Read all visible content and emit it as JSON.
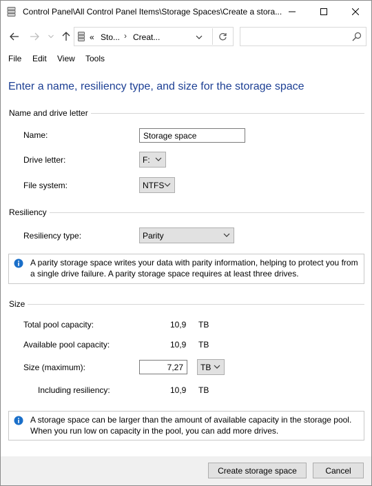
{
  "window": {
    "title": "Control Panel\\All Control Panel Items\\Storage Spaces\\Create a stora...",
    "minimize_glyph": "—",
    "maximize_glyph": "☐",
    "close_glyph": "✕"
  },
  "address": {
    "chevron": "«",
    "crumbs": [
      "Sto...",
      "Creat..."
    ],
    "separator": "›",
    "search_placeholder": ""
  },
  "menu": {
    "items": [
      "File",
      "Edit",
      "View",
      "Tools"
    ]
  },
  "heading": "Enter a name, resiliency type, and size for the storage space",
  "name_section": {
    "title": "Name and drive letter",
    "name_label": "Name:",
    "name_value": "Storage space",
    "drive_label": "Drive letter:",
    "drive_value": "F:",
    "fs_label": "File system:",
    "fs_value": "NTFS"
  },
  "resiliency_section": {
    "title": "Resiliency",
    "type_label": "Resiliency type:",
    "type_value": "Parity",
    "info": "A parity storage space writes your data with parity information, helping to protect you from a single drive failure. A parity storage space requires at least three drives."
  },
  "size_section": {
    "title": "Size",
    "total_label": "Total pool capacity:",
    "total_value": "10,9",
    "total_unit": "TB",
    "available_label": "Available pool capacity:",
    "available_value": "10,9",
    "available_unit": "TB",
    "size_label": "Size (maximum):",
    "size_value": "7,27",
    "size_unit": "TB",
    "including_label": "Including resiliency:",
    "including_value": "10,9",
    "including_unit": "TB",
    "info": "A storage space can be larger than the amount of available capacity in the storage pool. When you run low on capacity in the pool, you can add more drives."
  },
  "buttons": {
    "create": "Create storage space",
    "cancel": "Cancel"
  },
  "colors": {
    "heading": "#1c3f94",
    "info_icon": "#1a6fc9"
  }
}
